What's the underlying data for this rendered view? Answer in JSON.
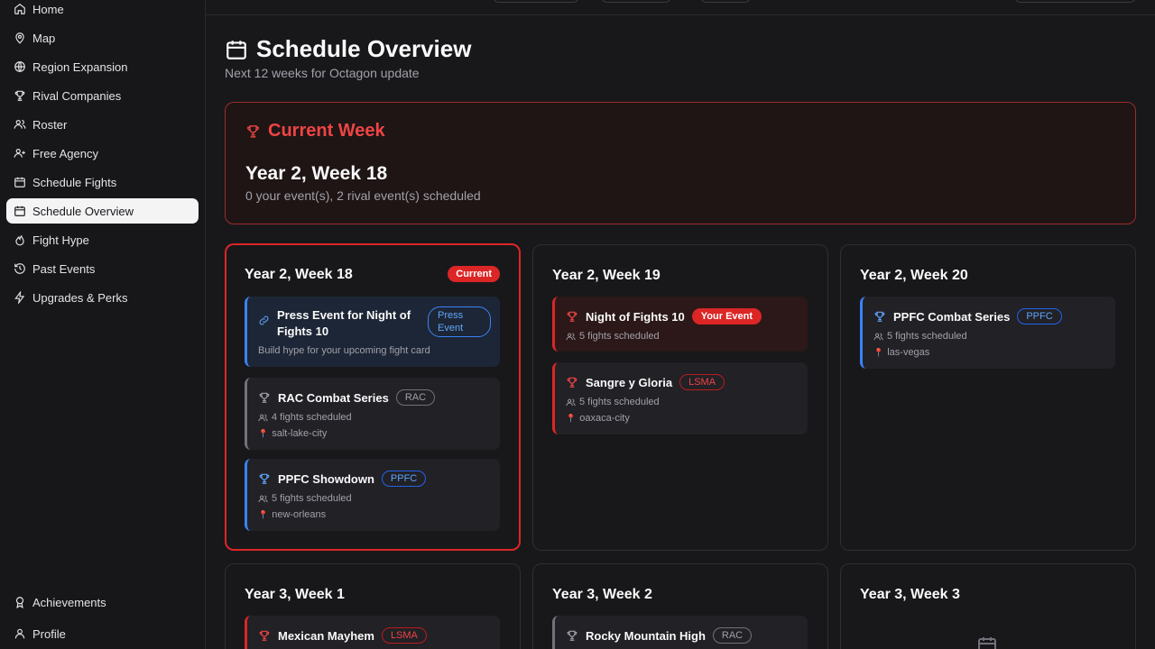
{
  "sidebar": {
    "items": [
      {
        "label": "Home",
        "icon": "home-icon",
        "active": false
      },
      {
        "label": "Map",
        "icon": "map-pin-icon",
        "active": false
      },
      {
        "label": "Region Expansion",
        "icon": "globe-icon",
        "active": false
      },
      {
        "label": "Rival Companies",
        "icon": "trophy-icon",
        "active": false
      },
      {
        "label": "Roster",
        "icon": "users-icon",
        "active": false
      },
      {
        "label": "Free Agency",
        "icon": "user-plus-icon",
        "active": false
      },
      {
        "label": "Schedule Fights",
        "icon": "calendar-icon",
        "active": false
      },
      {
        "label": "Schedule Overview",
        "icon": "calendar-icon",
        "active": true
      },
      {
        "label": "Fight Hype",
        "icon": "flame-icon",
        "active": false
      },
      {
        "label": "Past Events",
        "icon": "history-icon",
        "active": false
      },
      {
        "label": "Upgrades & Perks",
        "icon": "zap-icon",
        "active": false
      }
    ],
    "bottom": [
      {
        "label": "Achievements",
        "icon": "award-icon"
      },
      {
        "label": "Profile",
        "icon": "user-icon"
      }
    ]
  },
  "page": {
    "title": "Schedule Overview",
    "subtitle": "Next 12 weeks for Octagon update"
  },
  "current_week": {
    "label": "Current Week",
    "week": "Year 2, Week 18",
    "summary": "0 your event(s), 2 rival event(s) scheduled"
  },
  "weeks": [
    {
      "title": "Year 2, Week 18",
      "badge": "Current",
      "press": {
        "name": "Press Event for Night of Fights 10",
        "tag": "Press Event",
        "desc": "Build hype for your upcoming fight card"
      },
      "events": [
        {
          "name": "RAC Combat Series",
          "tag": "RAC",
          "fights": "4 fights scheduled",
          "location": "salt-lake-city"
        },
        {
          "name": "PPFC Showdown",
          "tag": "PPFC",
          "fights": "5 fights scheduled",
          "location": "new-orleans"
        }
      ]
    },
    {
      "title": "Year 2, Week 19",
      "events": [
        {
          "name": "Night of Fights 10",
          "tag": "Your Event",
          "fights": "5 fights scheduled"
        },
        {
          "name": "Sangre y Gloria",
          "tag": "LSMA",
          "fights": "5 fights scheduled",
          "location": "oaxaca-city"
        }
      ]
    },
    {
      "title": "Year 2, Week 20",
      "events": [
        {
          "name": "PPFC Combat Series",
          "tag": "PPFC",
          "fights": "5 fights scheduled",
          "location": "las-vegas"
        }
      ]
    },
    {
      "title": "Year 3, Week 1",
      "events": [
        {
          "name": "Mexican Mayhem",
          "tag": "LSMA"
        }
      ]
    },
    {
      "title": "Year 3, Week 2",
      "events": [
        {
          "name": "Rocky Mountain High",
          "tag": "RAC"
        }
      ]
    },
    {
      "title": "Year 3, Week 3"
    }
  ],
  "colors": {
    "accent_red": "#dc2626",
    "rival_blue": "#3b82f6",
    "rival_red_lsma": "#ef4444",
    "rival_gray_rac": "#71717a"
  }
}
